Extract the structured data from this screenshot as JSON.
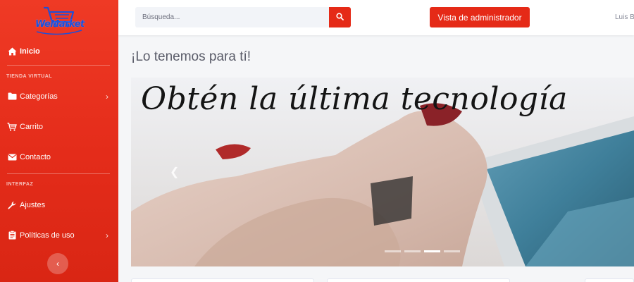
{
  "sidebar": {
    "brand": "WeMarket",
    "home_label": "Inicio",
    "section_store": "TIENDA VIRTUAL",
    "items_store": [
      {
        "label": "Categorías"
      },
      {
        "label": "Carrito"
      },
      {
        "label": "Contacto"
      }
    ],
    "section_interface": "INTERFAZ",
    "items_interface": [
      {
        "label": "Ajustes"
      },
      {
        "label": "Políticas de uso"
      }
    ]
  },
  "topbar": {
    "search_placeholder": "Búsqueda...",
    "admin_button": "Vista de administrador",
    "user_name": "Luis Bo"
  },
  "main": {
    "heading": "¡Lo tenemos para tí!",
    "carousel": {
      "caption": "Obtén la última tecnología",
      "slide_count": 4,
      "active_slide": 3
    }
  },
  "colors": {
    "primary": "#e52a17",
    "sidebar_top": "#ef3a25",
    "brand_logo": "#1f4fd8",
    "text_muted": "#5a5c69"
  }
}
